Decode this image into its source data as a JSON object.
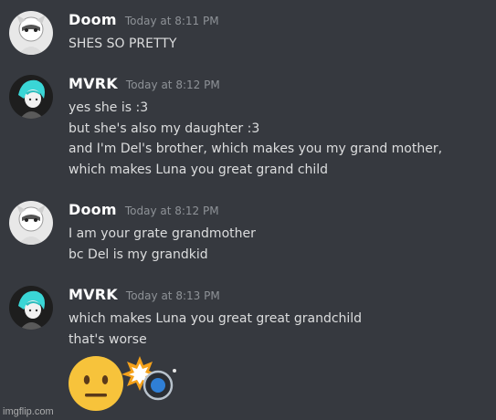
{
  "messages": [
    {
      "author": "Doom",
      "timestamp": "Today at 8:11 PM",
      "lines": [
        "SHES SO PRETTY"
      ]
    },
    {
      "author": "MVRK",
      "timestamp": "Today at 8:12 PM",
      "lines": [
        "yes she is :3",
        "but she's also my daughter :3",
        "and I'm Del's brother, which makes you my grand mother,",
        "which makes Luna you great grand child"
      ]
    },
    {
      "author": "Doom",
      "timestamp": "Today at 8:12 PM",
      "lines": [
        "I am your grate grandmother",
        "bc Del is my grandkid"
      ]
    },
    {
      "author": "MVRK",
      "timestamp": "Today at 8:13 PM",
      "lines": [
        "which makes Luna you great great grandchild",
        "that's worse"
      ],
      "emojis": [
        "neutral-face-emoji",
        "collision-emoji",
        "blue-circle-emoji"
      ]
    }
  ],
  "watermark": "imgflip.com",
  "colors": {
    "background": "#36393f",
    "username": "#ffffff",
    "timestamp": "#8e9297",
    "text": "#dcddde"
  }
}
